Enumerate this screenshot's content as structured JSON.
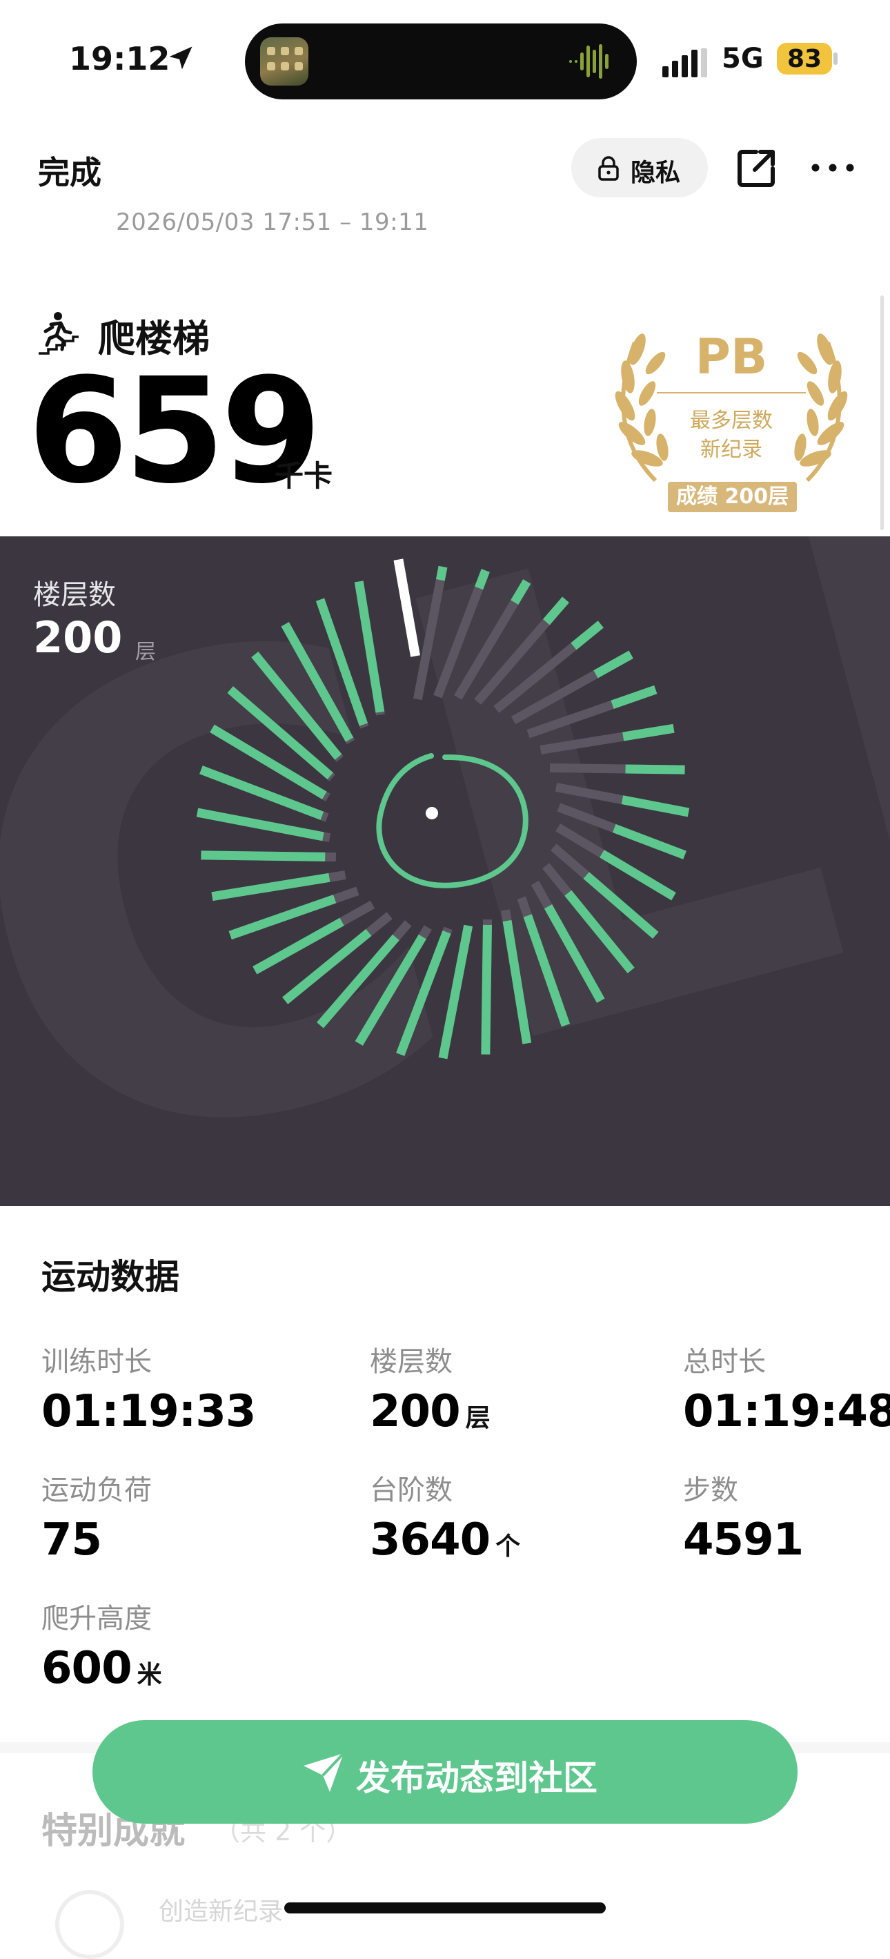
{
  "status_bar": {
    "time": "19:12",
    "network": "5G",
    "battery": "83",
    "battery_color": "#f2c43d"
  },
  "header": {
    "done_label": "完成",
    "privacy_label": "隐私",
    "time_range": "2026/05/03 17:51 – 19:11",
    "icons": [
      "lock-icon",
      "share-icon",
      "more-icon"
    ]
  },
  "activity": {
    "name": "爬楼梯",
    "calories": "659",
    "calories_unit": "千卡",
    "pb": {
      "title": "PB",
      "line1": "最多层数",
      "line2": "新纪录",
      "result": "成绩 200层",
      "color": "#d7b26a"
    }
  },
  "chart_panel": {
    "label": "楼层数",
    "value": "200",
    "unit": "层",
    "background_text": "CLIMB",
    "colors": {
      "panel": "#3b3640",
      "filled": "#5ec78d",
      "empty": "#5c5663",
      "marker": "#ffffff"
    }
  },
  "chart_data": {
    "type": "radial-bar",
    "title": "",
    "segments": 36,
    "values_fraction": [
      0.1,
      0.14,
      0.18,
      0.22,
      0.26,
      0.3,
      0.34,
      0.38,
      0.44,
      0.5,
      0.56,
      0.62,
      0.68,
      0.74,
      0.8,
      0.86,
      0.92,
      0.96,
      1.0,
      0.97,
      0.92,
      0.86,
      0.8,
      0.74,
      0.82,
      0.88,
      0.92,
      0.95,
      0.96,
      0.97,
      0.98,
      0.98,
      0.98,
      0.98,
      0.98,
      0.0
    ],
    "current_index": 35
  },
  "stats": {
    "title": "运动数据",
    "items": [
      {
        "label": "训练时长",
        "value": "01:19:33",
        "unit": ""
      },
      {
        "label": "楼层数",
        "value": "200",
        "unit": "层"
      },
      {
        "label": "总时长",
        "value": "01:19:48",
        "unit": ""
      },
      {
        "label": "运动负荷",
        "value": "75",
        "unit": ""
      },
      {
        "label": "台阶数",
        "value": "3640",
        "unit": "个"
      },
      {
        "label": "步数",
        "value": "4591",
        "unit": ""
      },
      {
        "label": "爬升高度",
        "value": "600",
        "unit": "米"
      }
    ]
  },
  "achievements": {
    "title": "特别成就",
    "count": "（共 2 个）",
    "first_item": "创造新纪录"
  },
  "post_button": {
    "label": "发布动态到社区",
    "color": "#5ec78d"
  }
}
